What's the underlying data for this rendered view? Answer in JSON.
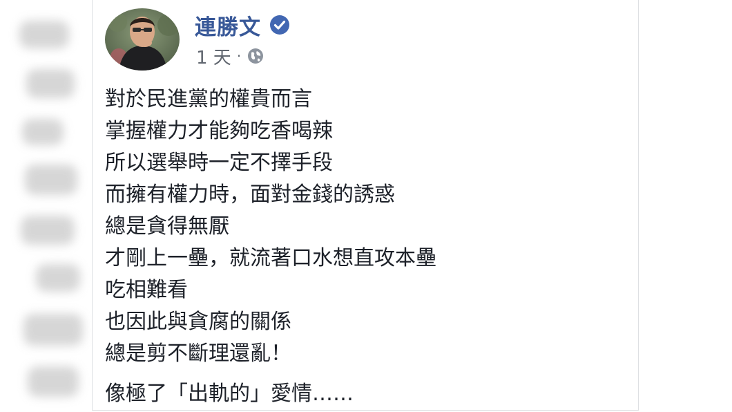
{
  "post": {
    "author_name": "連勝文",
    "timestamp": "1 天",
    "separator": "·",
    "privacy_icon": "globe-icon",
    "verified_icon": "verified-badge-icon",
    "lines": [
      "對於民進黨的權貴而言",
      "掌握權力才能夠吃香喝辣",
      "所以選舉時一定不擇手段",
      "而擁有權力時，面對金錢的誘惑",
      "總是貪得無厭",
      "才剛上一壘，就流著口水想直攻本壘",
      "吃相難看",
      "也因此與貪腐的關係",
      "總是剪不斷理還亂！",
      "像極了「出軌的」愛情……"
    ]
  },
  "colors": {
    "author_name": "#385898",
    "verified_badge": "#4267b2",
    "meta_text": "#616770",
    "body_text": "#1d2129",
    "card_border": "#dddfe2"
  }
}
